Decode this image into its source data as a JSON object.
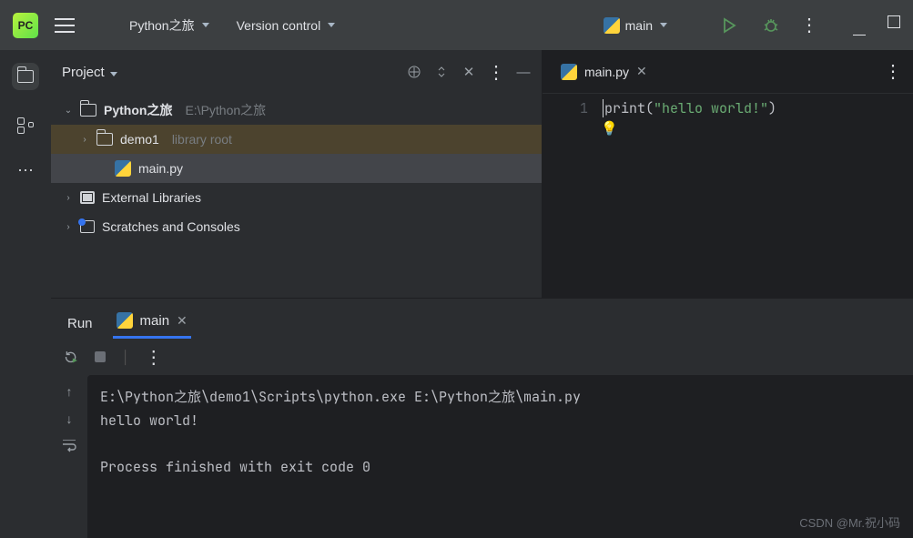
{
  "titlebar": {
    "logo": "PC",
    "project": "Python之旅",
    "vcs": "Version control",
    "run_config": "main"
  },
  "sidebar": {
    "items": [
      "project",
      "structure",
      "more"
    ]
  },
  "project_panel": {
    "title": "Project",
    "tree": {
      "root": {
        "name": "Python之旅",
        "path": "E:\\Python之旅"
      },
      "demo": {
        "name": "demo1",
        "hint": "library root"
      },
      "file": {
        "name": "main.py"
      },
      "ext": "External Libraries",
      "scratch": "Scratches and Consoles"
    }
  },
  "editor": {
    "tab": "main.py",
    "line_no": "1",
    "code": {
      "fn": "print",
      "open": "(",
      "str": "\"hello world!\"",
      "close": ")"
    }
  },
  "run": {
    "tab_label": "Run",
    "config_name": "main",
    "output": {
      "cmd": "E:\\Python之旅\\demo1\\Scripts\\python.exe E:\\Python之旅\\main.py",
      "out": "hello world!",
      "exit": "Process finished with exit code 0"
    }
  },
  "watermark": "CSDN @Mr.祝小码"
}
